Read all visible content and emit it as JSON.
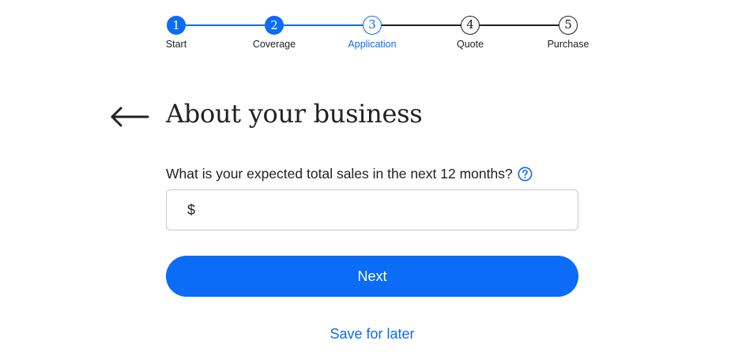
{
  "colors": {
    "accent": "#0a6cf7",
    "text": "#222222",
    "incomplete_step": "#1e1e1e",
    "input_border": "#c9c9c9"
  },
  "stepper": {
    "current_step": 3,
    "steps": [
      {
        "number": "1",
        "label": "Start",
        "state": "done"
      },
      {
        "number": "2",
        "label": "Coverage",
        "state": "done"
      },
      {
        "number": "3",
        "label": "Application",
        "state": "current"
      },
      {
        "number": "4",
        "label": "Quote",
        "state": "todo"
      },
      {
        "number": "5",
        "label": "Purchase",
        "state": "todo"
      }
    ]
  },
  "header": {
    "back_icon": "arrow-left-icon",
    "title": "About your business"
  },
  "form": {
    "question": "What is your expected total sales in the next 12 months?",
    "help_icon": "question-circle-icon",
    "currency_symbol": "$",
    "amount_value": "",
    "amount_placeholder": "",
    "next_label": "Next",
    "save_label": "Save for later"
  }
}
